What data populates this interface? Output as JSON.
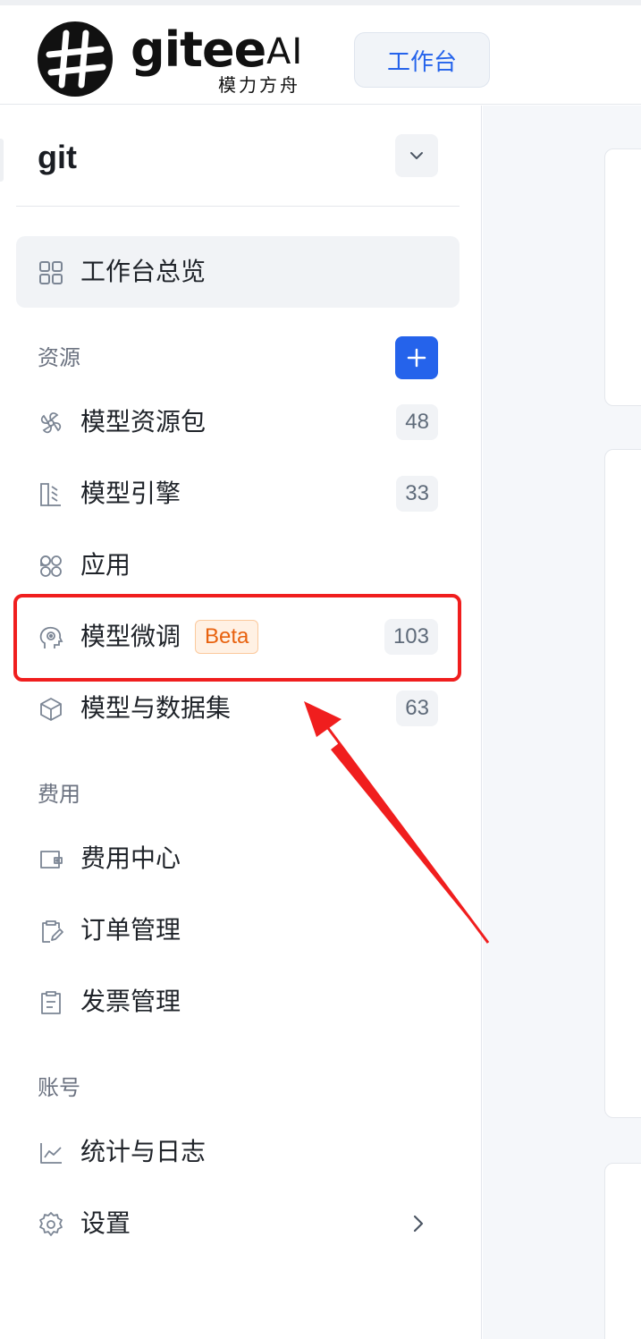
{
  "header": {
    "logo_text": "gitee",
    "logo_ai": "AI",
    "logo_subtitle": "模力方舟",
    "workbench_button": "工作台"
  },
  "workspace": {
    "name": "git"
  },
  "nav": {
    "overview": "工作台总览",
    "sections": {
      "resources": "资源",
      "billing": "费用",
      "account": "账号"
    },
    "resources": [
      {
        "label": "模型资源包",
        "count": "48",
        "icon": "fan-icon"
      },
      {
        "label": "模型引擎",
        "count": "33",
        "icon": "engine-icon"
      },
      {
        "label": "应用",
        "count": "",
        "icon": "apps-icon"
      },
      {
        "label": "模型微调",
        "count": "103",
        "badge": "Beta",
        "icon": "brain-icon"
      },
      {
        "label": "模型与数据集",
        "count": "63",
        "icon": "cube-icon"
      }
    ],
    "billing": [
      {
        "label": "费用中心",
        "icon": "wallet-icon"
      },
      {
        "label": "订单管理",
        "icon": "clipboard-edit-icon"
      },
      {
        "label": "发票管理",
        "icon": "clipboard-list-icon"
      }
    ],
    "account": [
      {
        "label": "统计与日志",
        "icon": "chart-icon"
      },
      {
        "label": "设置",
        "icon": "gear-icon"
      }
    ]
  },
  "colors": {
    "accent": "#2563eb",
    "highlight": "#f01e1e",
    "beta_text": "#e8620f"
  }
}
